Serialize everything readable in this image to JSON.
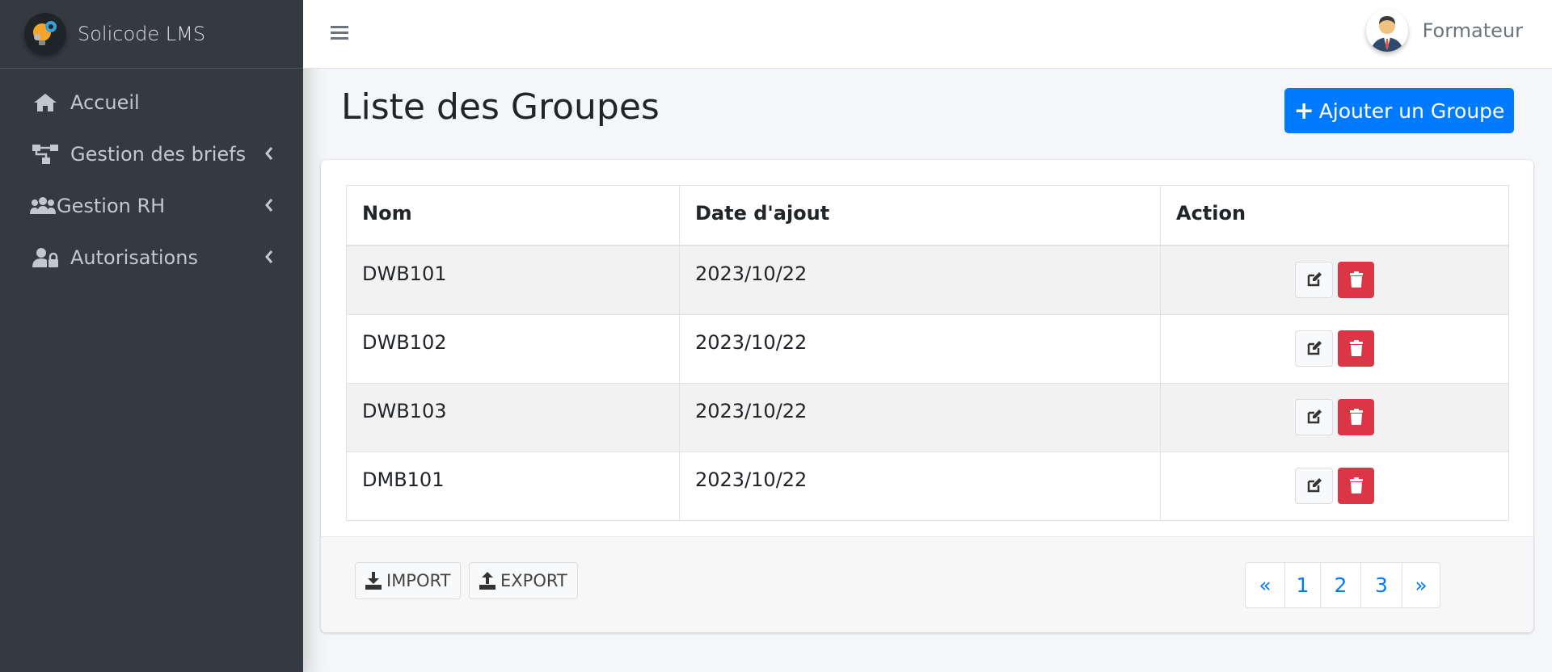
{
  "brand": {
    "name": "Solicode LMS"
  },
  "sidebar": {
    "items": [
      {
        "label": "Accueil",
        "icon": "home-icon"
      },
      {
        "label": "Gestion des briefs",
        "icon": "sitemap-icon"
      },
      {
        "label": "Gestion RH",
        "icon": "users-icon"
      },
      {
        "label": "Autorisations",
        "icon": "user-lock-icon"
      }
    ]
  },
  "navbar": {
    "user_name": "Formateur"
  },
  "header": {
    "title": "Liste des Groupes",
    "add_button": "Ajouter un Groupe"
  },
  "table": {
    "columns": [
      "Nom",
      "Date d'ajout",
      "Action"
    ],
    "rows": [
      {
        "nom": "DWB101",
        "date": "2023/10/22"
      },
      {
        "nom": "DWB102",
        "date": "2023/10/22"
      },
      {
        "nom": "DWB103",
        "date": "2023/10/22"
      },
      {
        "nom": "DMB101",
        "date": "2023/10/22"
      }
    ]
  },
  "footer": {
    "import_label": "IMPORT",
    "export_label": "EXPORT",
    "pagination": {
      "prev": "«",
      "pages": [
        "1",
        "2",
        "3"
      ],
      "next": "»"
    }
  },
  "colors": {
    "sidebar": "#343a40",
    "primary": "#007bff",
    "danger": "#dc3545"
  }
}
